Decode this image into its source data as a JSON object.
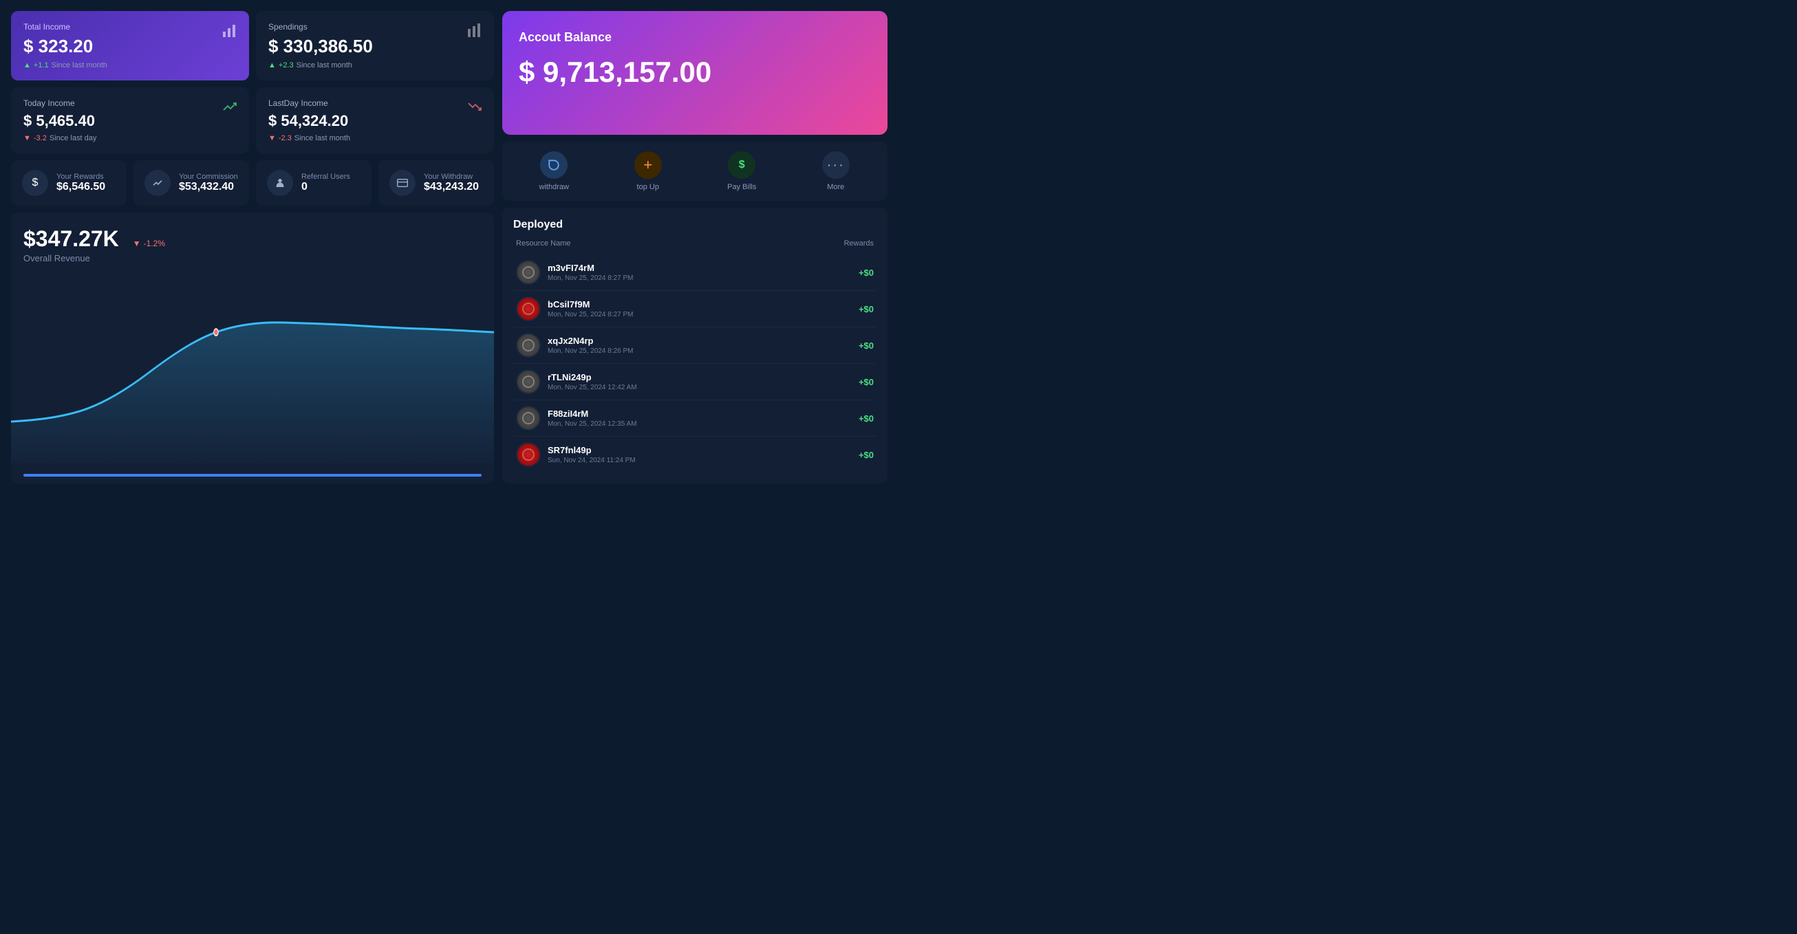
{
  "totalIncome": {
    "label": "Total Income",
    "value": "$ 323.20",
    "change": "+1.1",
    "changeLabel": "Since last month",
    "changeType": "positive"
  },
  "spendings": {
    "label": "Spendings",
    "value": "$ 330,386.50",
    "change": "+2.3",
    "changeLabel": "Since last month",
    "changeType": "positive"
  },
  "todayIncome": {
    "label": "Today Income",
    "value": "$ 5,465.40",
    "change": "-3.2",
    "changeLabel": "Since last day",
    "changeType": "negative"
  },
  "lastDayIncome": {
    "label": "LastDay Income",
    "value": "$ 54,324.20",
    "change": "-2.3",
    "changeLabel": "Since last month",
    "changeType": "negative"
  },
  "metrics": [
    {
      "label": "Your Rewards",
      "value": "$6,546.50",
      "icon": "$"
    },
    {
      "label": "Your Commission",
      "value": "$53,432.40",
      "icon": "~"
    },
    {
      "label": "Referral Users",
      "value": "0",
      "icon": "👤"
    },
    {
      "label": "Your Withdraw",
      "value": "$43,243.20",
      "icon": "🪪"
    }
  ],
  "chart": {
    "value": "$347.27K",
    "label": "Overall Revenue",
    "change": "-1.2%",
    "changeType": "negative"
  },
  "balance": {
    "title": "Accout Balance",
    "amount": "$ 9,713,157.00"
  },
  "actions": [
    {
      "label": "withdraw",
      "icon": "↺",
      "colorClass": "blue"
    },
    {
      "label": "top Up",
      "icon": "+",
      "colorClass": "orange"
    },
    {
      "label": "Pay Bills",
      "icon": "$",
      "colorClass": "green"
    },
    {
      "label": "More",
      "icon": "···",
      "colorClass": "gray"
    }
  ],
  "deployed": {
    "title": "Deployed",
    "columnResource": "Resource Name",
    "columnRewards": "Rewards",
    "items": [
      {
        "name": "m3vFI74rM",
        "date": "Mon, Nov 25, 2024 8:27 PM",
        "reward": "+$0",
        "avatarType": "gray"
      },
      {
        "name": "bCsil7f9M",
        "date": "Mon, Nov 25, 2024 8:27 PM",
        "reward": "+$0",
        "avatarType": "red"
      },
      {
        "name": "xqJx2N4rp",
        "date": "Mon, Nov 25, 2024 8:26 PM",
        "reward": "+$0",
        "avatarType": "gray"
      },
      {
        "name": "rTLNi249p",
        "date": "Mon, Nov 25, 2024 12:42 AM",
        "reward": "+$0",
        "avatarType": "gray"
      },
      {
        "name": "F88ziI4rM",
        "date": "Mon, Nov 25, 2024 12:35 AM",
        "reward": "+$0",
        "avatarType": "gray"
      },
      {
        "name": "SR7fnl49p",
        "date": "Sun, Nov 24, 2024 11:24 PM",
        "reward": "+$0",
        "avatarType": "red"
      }
    ]
  }
}
